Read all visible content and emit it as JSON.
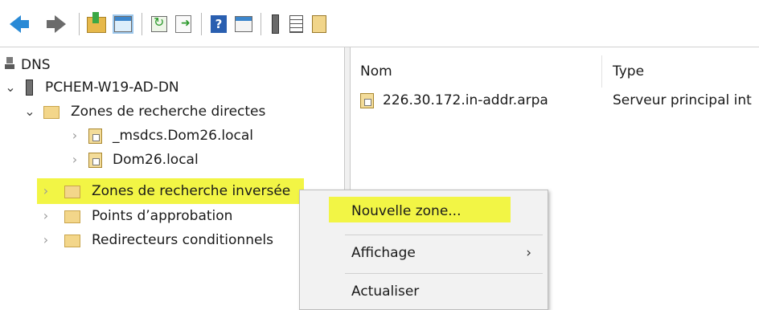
{
  "toolbar": {
    "icons": [
      "back-arrow-icon",
      "forward-arrow-icon",
      "up-folder-icon",
      "show-hide-console-tree-icon",
      "refresh-icon",
      "export-list-icon",
      "help-icon",
      "show-hide-action-pane-icon",
      "server-icon",
      "list-icon",
      "zone-file-icon"
    ],
    "help_glyph": "?"
  },
  "tree": {
    "root": "DNS",
    "server": "PCHEM-W19-AD-DN",
    "forward_zones": "Zones de recherche directes",
    "forward_children": [
      "_msdcs.Dom26.local",
      "Dom26.local"
    ],
    "reverse_zones": "Zones de recherche inversée",
    "trust_points": "Points d’approbation",
    "conditional_forwarders": "Redirecteurs conditionnels"
  },
  "list": {
    "columns": [
      "Nom",
      "Type"
    ],
    "rows": [
      {
        "name": "226.30.172.in-addr.arpa",
        "type": "Serveur principal int"
      }
    ]
  },
  "context_menu": {
    "items": [
      "Nouvelle zone...",
      "Affichage",
      "Actualiser"
    ],
    "submenu_glyph": "›"
  },
  "colors": {
    "highlight": "#f2f545",
    "accent_arrow": "#2a8ad6"
  }
}
